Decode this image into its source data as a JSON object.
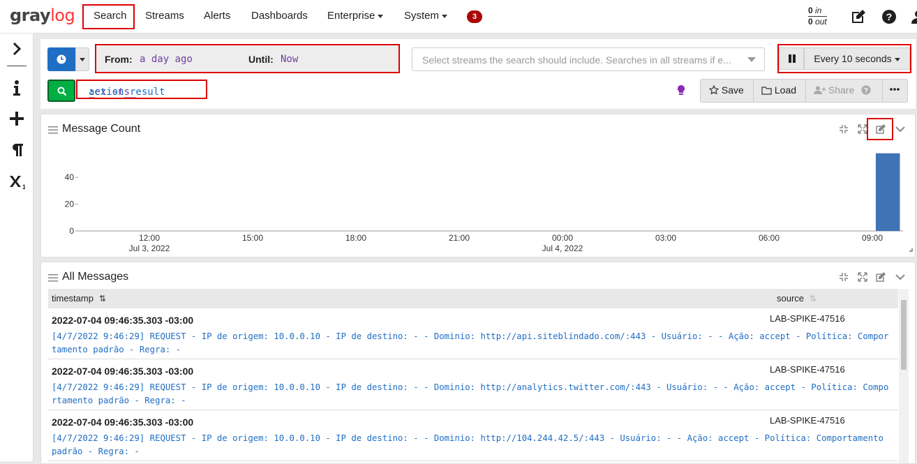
{
  "navbar": {
    "logo_part1": "gray",
    "logo_part2": "log",
    "items": [
      "Search",
      "Streams",
      "Alerts",
      "Dashboards",
      "Enterprise",
      "System"
    ],
    "notification_count": "3",
    "throughput_in_value": "0",
    "throughput_in_label": "in",
    "throughput_out_value": "0",
    "throughput_out_label": "out"
  },
  "sidebar": {
    "icons": [
      "chevron-right-icon",
      "info-icon",
      "plus-icon",
      "paragraph-icon",
      "subscript-icon"
    ]
  },
  "search": {
    "from_label": "From",
    "from_value": "a day ago",
    "until_label": "Until",
    "until_value": "Now",
    "streams_placeholder": "Select streams the search should include. Searches in all streams if e...",
    "refresh_label": "Every 10 seconds",
    "query_key": "_exists_",
    "query_colon": ":",
    "query_value": "action_result",
    "save_label": "Save",
    "load_label": "Load",
    "share_label": "Share"
  },
  "message_count": {
    "title": "Message Count"
  },
  "chart_data": {
    "type": "bar",
    "title": "Message Count",
    "x_ticks": [
      {
        "label": "12:00",
        "sublabel": "Jul 3, 2022"
      },
      {
        "label": "15:00",
        "sublabel": ""
      },
      {
        "label": "18:00",
        "sublabel": ""
      },
      {
        "label": "21:00",
        "sublabel": ""
      },
      {
        "label": "00:00",
        "sublabel": "Jul 4, 2022"
      },
      {
        "label": "03:00",
        "sublabel": ""
      },
      {
        "label": "06:00",
        "sublabel": ""
      },
      {
        "label": "09:00",
        "sublabel": ""
      }
    ],
    "y_ticks": [
      0,
      20,
      40
    ],
    "ylim": [
      0,
      62
    ],
    "bars": [
      {
        "x_hours_from_first_tick": 21.1,
        "width_hours": 0.7,
        "value": 58
      }
    ],
    "bar_color": "#3f73b5"
  },
  "all_messages": {
    "title": "All Messages",
    "columns": [
      "timestamp",
      "source"
    ],
    "rows": [
      {
        "timestamp": "2022-07-04 09:46:35.303 -03:00",
        "source": "LAB-SPIKE-47516",
        "message": "[4/7/2022 9:46:29] REQUEST - IP de origem: 10.0.0.10 - IP de destino: - - Dominio: http://api.siteblindado.com/:443 - Usuário: - - Ação: accept - Política: Comportamento padrão - Regra: -"
      },
      {
        "timestamp": "2022-07-04 09:46:35.303 -03:00",
        "source": "LAB-SPIKE-47516",
        "message": "[4/7/2022 9:46:29] REQUEST - IP de origem: 10.0.0.10 - IP de destino: - - Dominio: http://analytics.twitter.com/:443 - Usuário: - - Ação: accept - Política: Comportamento padrão - Regra: -"
      },
      {
        "timestamp": "2022-07-04 09:46:35.303 -03:00",
        "source": "LAB-SPIKE-47516",
        "message": "[4/7/2022 9:46:29] REQUEST - IP de origem: 10.0.0.10 - IP de destino: - - Dominio: http://104.244.42.5/:443 - Usuário: - - Ação: accept - Política: Comportamento padrão - Regra: -"
      }
    ]
  }
}
